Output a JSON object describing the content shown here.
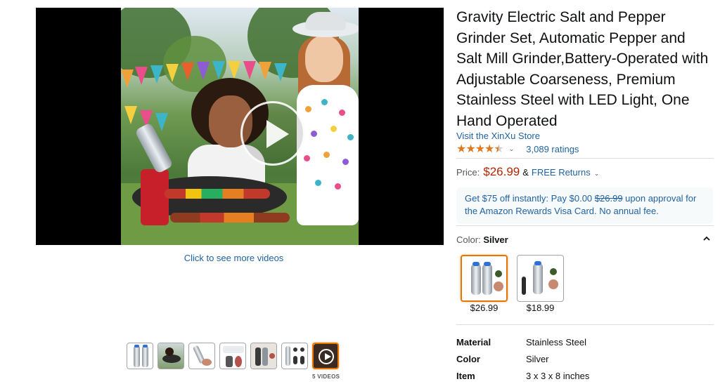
{
  "media": {
    "more_videos_link": "Click to see more videos",
    "videos_count": "5 VIDEOS",
    "thumbnails": [
      "grinder-pair",
      "grilling",
      "grinder-salt",
      "grinder-pepper",
      "grinder-set",
      "grinder-accessories",
      "video"
    ]
  },
  "product": {
    "title": "Gravity Electric Salt and Pepper Grinder Set, Automatic Pepper and Salt Mill Grinder,Battery-Operated with Adjustable Coarseness, Premium Stainless Steel with LED Light, One Hand Operated",
    "store_link": "Visit the XinXu Store",
    "rating_stars": "4.5",
    "ratings_count": "3,089 ratings",
    "price_label": "Price:",
    "price": "$26.99",
    "amp": "&",
    "returns_link": "FREE Returns",
    "promo": {
      "prefix": "Get $75 off instantly: Pay $0.00 ",
      "strike_price": "$26.99",
      "suffix": " upon approval for the Amazon Rewards Visa Card. No annual fee."
    },
    "color_label": "Color:",
    "color_value": "Silver",
    "variants": [
      {
        "price": "$26.99",
        "selected": true
      },
      {
        "price": "$18.99",
        "selected": false
      }
    ],
    "specs": [
      {
        "key": "Material",
        "value": "Stainless Steel"
      },
      {
        "key": "Color",
        "value": "Silver"
      },
      {
        "key": "Item",
        "value": "3 x 3 x 8 inches"
      }
    ]
  },
  "colors": {
    "link": "#2162a1",
    "price": "#b12704",
    "star": "#de7921",
    "selected_border": "#e77600"
  }
}
